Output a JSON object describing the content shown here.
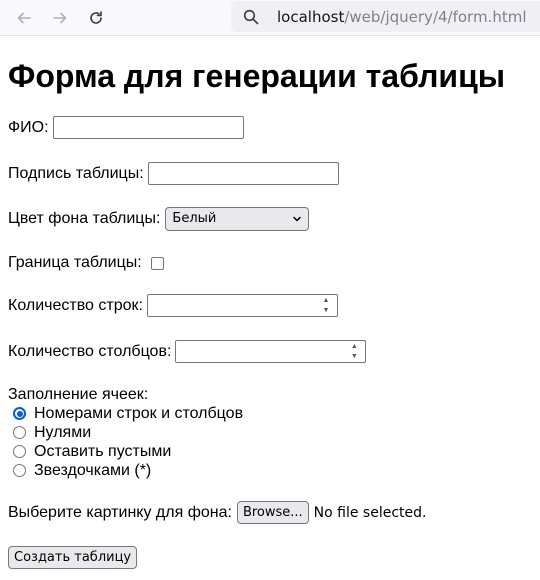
{
  "browser": {
    "url_host": "localhost",
    "url_path": "/web/jquery/4/form.html"
  },
  "page": {
    "heading": "Форма для генерации таблицы"
  },
  "form": {
    "fio_label": "ФИО:",
    "fio_value": "",
    "caption_label": "Подпись таблицы:",
    "caption_value": "",
    "bg_color_label": "Цвет фона таблицы:",
    "bg_color_selected": "Белый",
    "border_label": "Граница таблицы:",
    "border_checked": false,
    "rows_label": "Количество строк:",
    "rows_value": "",
    "cols_label": "Количество столбцов:",
    "cols_value": "",
    "fill_label": "Заполнение ячеек:",
    "fill_options": [
      {
        "label": "Номерами строк и столбцов",
        "checked": true
      },
      {
        "label": "Нулями",
        "checked": false
      },
      {
        "label": "Оставить пустыми",
        "checked": false
      },
      {
        "label": "Звездочками (*)",
        "checked": false
      }
    ],
    "bg_image_label": "Выберите картинку для фона:",
    "browse_label": "Browse...",
    "no_file_text": "No file selected.",
    "submit_label": "Создать таблицу"
  },
  "colors": {
    "accent": "#0060df",
    "toolbar_bg": "#f9f9fb",
    "urlbar_bg": "#f0f0f4"
  }
}
